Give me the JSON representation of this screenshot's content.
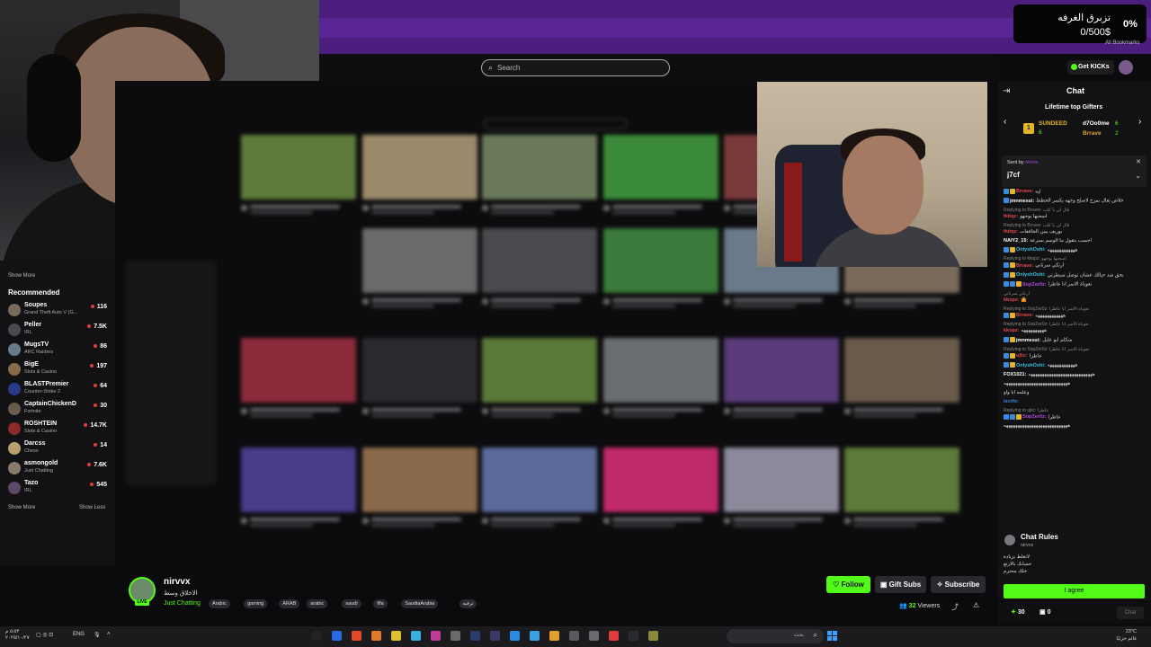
{
  "goal": {
    "percent": "0%",
    "title": "تزبرق الغرفه",
    "amount": "0/500$"
  },
  "bookmark_hint": "All Bookmarks",
  "header": {
    "search_placeholder": "Search",
    "kicks_label": "Get KICKs"
  },
  "sidebar": {
    "show_more_top": "Show More",
    "recommended_title": "Recommended",
    "items": [
      {
        "name": "Soupes",
        "category": "Grand Theft Auto V (G...",
        "viewers": "116",
        "color": "#7a6a5a"
      },
      {
        "name": "Peller",
        "category": "IRL",
        "viewers": "7.5K",
        "color": "#4a4a4e"
      },
      {
        "name": "MugsTV",
        "category": "ARC Raiders",
        "viewers": "86",
        "color": "#6a7a8a"
      },
      {
        "name": "BigE",
        "category": "Slots & Casino",
        "viewers": "197",
        "color": "#8a6a4a"
      },
      {
        "name": "BLASTPremier",
        "category": "Counter-Strike 2",
        "viewers": "64",
        "color": "#2a3a8a"
      },
      {
        "name": "CaptainChickenD",
        "category": "Fortnite",
        "viewers": "30",
        "color": "#6a5a4a"
      },
      {
        "name": "ROSHTEIN",
        "category": "Slots & Casino",
        "viewers": "14.7K",
        "color": "#8a2a2a"
      },
      {
        "name": "Darcss",
        "category": "Chess",
        "viewers": "14",
        "color": "#b8a070"
      },
      {
        "name": "asmongold",
        "category": "Just Chatting",
        "viewers": "7.6K",
        "color": "#8a7a6a"
      },
      {
        "name": "Tazo",
        "category": "IRL",
        "viewers": "545",
        "color": "#5a4a6a"
      }
    ],
    "show_more_bottom": "Show More",
    "show_less": "Show Less"
  },
  "chat": {
    "title": "Chat",
    "gifters_title": "Lifetime top Gifters",
    "gifters": [
      {
        "rank": "1",
        "name": "SUNDEED",
        "count": "6",
        "color": "#e4b52a"
      },
      {
        "name": "d7Oo0me",
        "count": "6",
        "color": "#ffffff"
      },
      {
        "name": "Brrave",
        "count": "2",
        "color": "#d9a33a"
      }
    ],
    "pinned": {
      "label": "Sent by",
      "user": "nirvvx",
      "text": "j7cf"
    },
    "messages": [
      {
        "user": "Brrave:",
        "color": "#e14b4b",
        "text": "ليه",
        "badges": [
          "#3a8ae0",
          "#e4b52a"
        ]
      },
      {
        "user": "jmnmessi:",
        "color": "#ffffff",
        "text": "خلاص تعال نمزح لاصلح وجهه يكسر الحظظ",
        "badges": [
          "#3a8ae0"
        ]
      },
      {
        "reply": "Replying to Brrave: قال لي يا كلب",
        "user": "tkitqz:",
        "color": "#e14b4b",
        "text": "اسحبها يوجهو",
        "badges": []
      },
      {
        "reply": "Replying to Brrave: قال لي يا كلب",
        "user": "tkitqz:",
        "color": "#e14b4b",
        "text": "بوريف يبين الخافقات",
        "badges": []
      },
      {
        "user": "NAIY2_15:",
        "color": "#ffffff",
        "text": "احسب يتقول ما الوسم بسرعة",
        "badges": []
      },
      {
        "user": "OnlyshOshi:",
        "color": "#3ac0e0",
        "text": "ههههههههههههه",
        "badges": [
          "#3a8ae0",
          "#e4b52a"
        ]
      },
      {
        "reply": "Replying to kkopz: اسحبها يوجهو",
        "user": "Brrave:",
        "color": "#e14b4b",
        "text": "ارتكي سرتاني",
        "badges": [
          "#3a8ae0",
          "#e4b52a"
        ]
      },
      {
        "user": "OnlyshOshi:",
        "color": "#3ac0e0",
        "text": "بحق شد حيالك عشان توصل سيطرتي",
        "badges": [
          "#3a8ae0",
          "#e4b52a"
        ]
      },
      {
        "user": "SopZer0z:",
        "color": "#b04ae0",
        "text": "تعوياة الاسر انا عاطرا",
        "badges": [
          "#3a8ae0",
          "#3a8ae0",
          "#e4b52a"
        ]
      },
      {
        "reply": "ارتكي سرتاني",
        "user": "kkopz:",
        "color": "#e14b4b",
        "text": "🤷",
        "badges": []
      },
      {
        "reply": "Replying to SopZer0z: تعوياة الاسر انا عاطرا",
        "user": "Brrave:",
        "color": "#e14b4b",
        "text": "ههههههههههههه",
        "badges": [
          "#3a8ae0",
          "#e4b52a"
        ]
      },
      {
        "reply": "Replying to SopZer0z: تعوياة الاسر انا عاطرا",
        "user": "kkopz:",
        "color": "#e14b4b",
        "text": "ههههههههههه",
        "badges": []
      },
      {
        "user": "jmnmessi:",
        "color": "#ffffff",
        "text": "منكلم ابو عليل",
        "badges": [
          "#3a8ae0",
          "#e4b52a"
        ]
      },
      {
        "reply": "Replying to SopZer0z: تعوياة الاسر انا عاطرا",
        "user": "ujlic:",
        "color": "#e14b4b",
        "text": "عاطرا",
        "badges": [
          "#3a8ae0",
          "#e4b52a"
        ]
      },
      {
        "user": "OnlyshOshi:",
        "color": "#3ac0e0",
        "text": "ههههههههههههه",
        "badges": [
          "#3a8ae0",
          "#e4b52a"
        ]
      },
      {
        "user": "FOX1021:",
        "color": "#ffffff",
        "text": "ههههههههههههههههههههههههههههه",
        "badges": []
      },
      {
        "user": "",
        "color": "#ffffff",
        "text": "ههههههههههههههههههههههههههههه",
        "badges": []
      },
      {
        "user": "",
        "color": "#ffffff",
        "text": "وعلمه انا واو",
        "badges": []
      },
      {
        "user": "iscrfo:",
        "color": "#3a8ae0",
        "text": "",
        "badges": []
      },
      {
        "reply": "Replying to ujlic: عاطرا",
        "user": "SopZer0z:",
        "color": "#b04ae0",
        "text": "عاطرا",
        "badges": [
          "#3a8ae0",
          "#3a8ae0",
          "#e4b52a"
        ]
      },
      {
        "user": "",
        "color": "#ffffff",
        "text": "ههههههههههههههههههههههههههههه",
        "badges": []
      }
    ],
    "rules": {
      "title": "Chat Rules",
      "user": "nirvvx",
      "lines": [
        "لاتغلط بزيادة",
        "حسابك بالارتع",
        "خلك محترم"
      ]
    },
    "agree_label": "I agree",
    "points": "30",
    "gifts": "0",
    "send_label": "Chat"
  },
  "stream": {
    "streamer": "nirvvx",
    "live": "LIVE",
    "title": "الاخلاق وسط",
    "category": "Just Chatting",
    "tags": [
      "Arabic",
      "gaming",
      "ARAB",
      "arabic",
      "saudi",
      "fifa",
      "SaudiaArabia",
      "ترفيه"
    ],
    "follow_label": "Follow",
    "gift_subs_label": "Gift Subs",
    "subscribe_label": "Subscribe",
    "viewers_count": "32",
    "viewers_label": "Viewers"
  },
  "taskbar": {
    "clock": "٥:٥٣ م\n٢٠٢٥/١٠/٢٧",
    "lang": "ENG",
    "search_text": "بحث",
    "weather": "23°C\nغائم جزئيًا"
  }
}
